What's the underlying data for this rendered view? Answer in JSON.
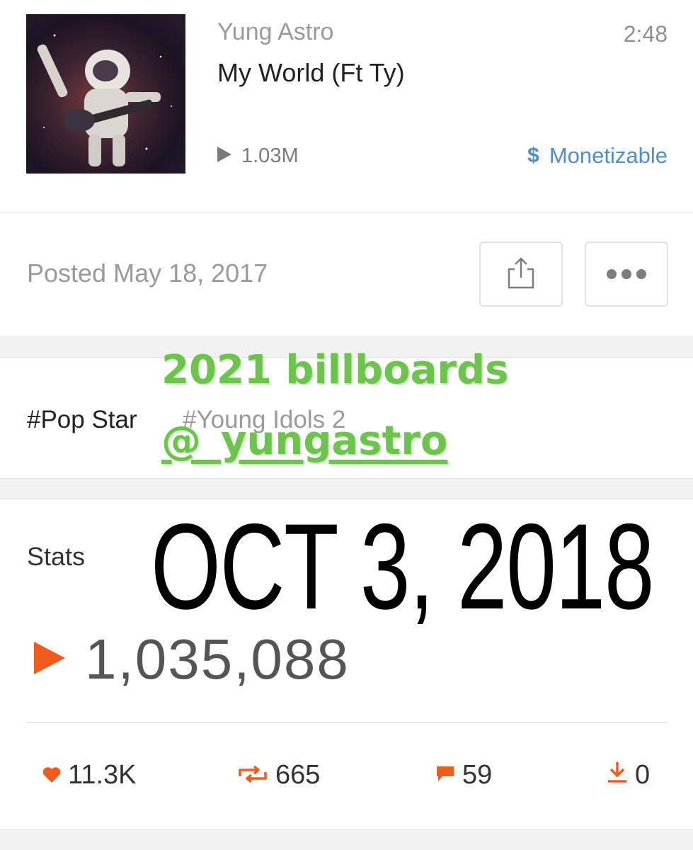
{
  "track": {
    "artist": "Yung Astro",
    "title": "My World (Ft Ty)",
    "duration": "2:48",
    "plays_short": "1.03M",
    "monetization_symbol": "$",
    "monetization_label": "Monetizable"
  },
  "post": {
    "posted_label": "Posted May 18, 2017"
  },
  "tags": [
    "#Pop Star",
    "#Young Idols 2"
  ],
  "overlay": {
    "line1": "2021 billboards",
    "line2": "@_yungastro",
    "date": "OCT 3, 2018"
  },
  "stats": {
    "label": "Stats",
    "total_plays": "1,035,088",
    "likes": "11.3K",
    "reposts": "665",
    "comments": "59",
    "downloads": "0"
  },
  "colors": {
    "accent_orange": "#f35b1c",
    "monetizable_blue": "#4b8fd0",
    "overlay_green": "#6dc44c"
  },
  "icons": [
    "play-icon",
    "dollar-icon",
    "share-icon",
    "more-icon",
    "heart-icon",
    "repost-icon",
    "comment-icon",
    "download-icon"
  ]
}
